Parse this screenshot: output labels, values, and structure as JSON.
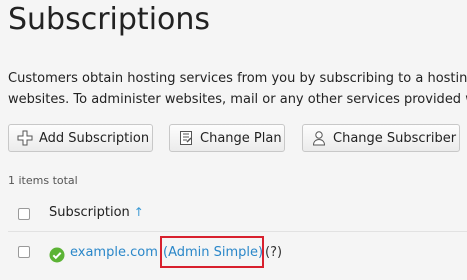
{
  "page": {
    "title": "Subscriptions",
    "description_line1": "Customers obtain hosting services from you by subscribing to a hostin",
    "description_line2": "websites. To administer websites, mail or any other services provided w"
  },
  "toolbar": {
    "add_subscription": "Add Subscription",
    "change_plan": "Change Plan",
    "change_subscriber": "Change Subscriber"
  },
  "list": {
    "items_total": "1 items total",
    "column_header": "Subscription",
    "sort_indicator": "↑",
    "rows": [
      {
        "domain": "example.com",
        "plan": "(Admin Simple)",
        "help": "(?)",
        "status": "ok"
      }
    ]
  },
  "colors": {
    "link": "#2a87c9",
    "highlight_border": "#d8202d",
    "status_ok": "#5cb335"
  },
  "icons": {
    "add": "add-icon",
    "change_plan": "change-plan-icon",
    "change_subscriber": "user-icon",
    "status": "status-ok-icon"
  }
}
